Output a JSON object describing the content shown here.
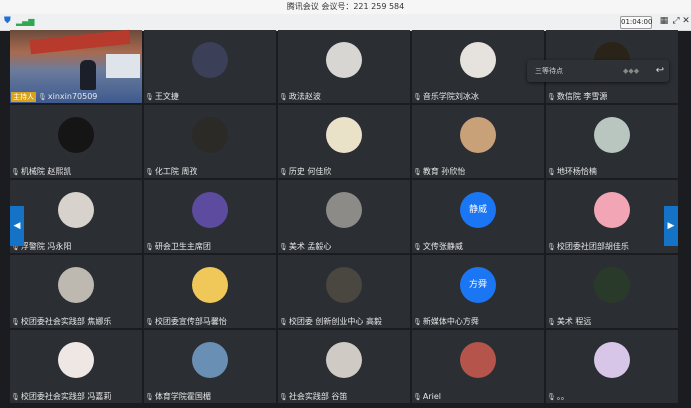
{
  "window": {
    "title": "腾讯会议 会议号：221 259 584"
  },
  "toolbar": {
    "timer": "01:04:00",
    "icons": {
      "shield": "shield-icon",
      "signal": "signal-icon",
      "grid": "grid-icon",
      "fullscreen": "fullscreen-icon",
      "close": "close-icon"
    }
  },
  "popup": {
    "text": "三等待点",
    "chevrons": "◆◆◆",
    "back": "↩"
  },
  "nav": {
    "prev": "◀",
    "next": "▶"
  },
  "host_label": "主持人",
  "participants": [
    {
      "name": "xinxin70509",
      "avatar_color": "#3a4a6a",
      "is_host": true,
      "is_video": true
    },
    {
      "name": "王文捷",
      "avatar_color": "#3b3f57"
    },
    {
      "name": "政法赵波",
      "avatar_color": "#d8d6d2"
    },
    {
      "name": "音乐学院刘冰冰",
      "avatar_color": "#e6e2dd"
    },
    {
      "name": "数信院 李雪源",
      "avatar_color": "#2a2418"
    },
    {
      "name": "机械院 赵熙凯",
      "avatar_color": "#151515"
    },
    {
      "name": "化工院 周孜",
      "avatar_color": "#2c2a27"
    },
    {
      "name": "历史 何佳欣",
      "avatar_color": "#eae2c8"
    },
    {
      "name": "教育 孙欣怡",
      "avatar_color": "#c9a179"
    },
    {
      "name": "地环杨恰楠",
      "avatar_color": "#b9c6c0"
    },
    {
      "name": "浮警院 冯永阳",
      "avatar_color": "#d8d2cc"
    },
    {
      "name": "研会卫生主席团",
      "avatar_color": "#5c4b9e"
    },
    {
      "name": "美术 孟毅心",
      "avatar_color": "#8c8b88"
    },
    {
      "name": "文传张静威",
      "avatar_color": "#1b76f3",
      "avatar_text": "静威"
    },
    {
      "name": "校团委社团部胡佳乐",
      "avatar_color": "#f2a6b5"
    },
    {
      "name": "校团委社会实践部 焦娜乐",
      "avatar_color": "#bdb8b0"
    },
    {
      "name": "校团委宣传部马馨怡",
      "avatar_color": "#f0c85a"
    },
    {
      "name": "校团委 创新创业中心 高毅",
      "avatar_color": "#4a4640"
    },
    {
      "name": "新媒体中心方舜",
      "avatar_color": "#1b76f3",
      "avatar_text": "方舜"
    },
    {
      "name": "美术 程远",
      "avatar_color": "#2a3a2a"
    },
    {
      "name": "校团委社会实践部 冯嘉莉",
      "avatar_color": "#efe7e4"
    },
    {
      "name": "体育学院霍国楣",
      "avatar_color": "#6a8fb5"
    },
    {
      "name": "社会实践部 谷笛",
      "avatar_color": "#cfcbc4"
    },
    {
      "name": "Ariel",
      "avatar_color": "#b4544a"
    },
    {
      "name": "。。",
      "avatar_color": "#d8c6e8"
    }
  ]
}
